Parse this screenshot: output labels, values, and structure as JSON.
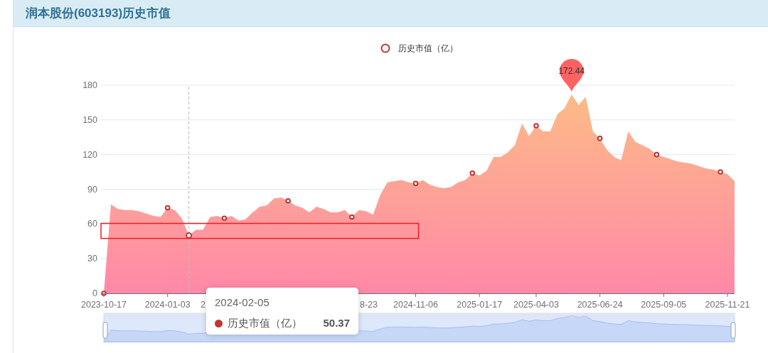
{
  "panel": {
    "title": "润本股份(603193)历史市值"
  },
  "chart": {
    "legend": {
      "color": "#c23531"
    },
    "chart_data": {
      "type": "area",
      "grid": true,
      "categories": [
        "2023-10-17",
        null,
        null,
        null,
        null,
        null,
        null,
        null,
        null,
        "2024-01-03",
        null,
        null,
        null,
        null,
        null,
        null,
        null,
        null,
        null,
        null,
        null,
        null,
        null,
        null,
        null,
        null,
        null,
        null,
        null,
        null,
        null,
        null,
        null,
        null,
        null,
        null,
        null,
        null,
        null,
        null,
        null,
        null,
        null,
        null,
        "2024-11-06",
        null,
        null,
        null,
        null,
        null,
        null,
        null,
        null,
        "2025-01-17",
        null,
        null,
        null,
        null,
        null,
        null,
        null,
        "2025-04-03",
        null,
        null,
        null,
        null,
        null,
        null,
        null,
        null,
        "2025-06-24",
        null,
        null,
        null,
        null,
        null,
        null,
        null,
        null,
        "2025-09-05",
        null,
        null,
        null,
        null,
        null,
        null,
        null,
        null,
        "2025-11-21",
        null
      ],
      "series": [
        {
          "name": "历史市值（亿）",
          "color": "#fdbb87",
          "values": [
            0,
            77,
            73,
            72,
            72,
            71,
            69,
            67,
            66,
            74,
            72,
            65,
            50,
            55,
            55,
            66,
            67,
            65,
            67,
            63,
            64,
            70,
            75,
            76,
            82,
            83,
            80,
            76,
            74,
            70,
            75,
            73,
            70,
            70,
            72,
            66,
            72,
            71,
            68,
            85,
            96,
            97,
            98,
            96,
            95,
            98,
            94,
            92,
            91,
            92,
            96,
            98,
            104,
            102,
            106,
            118,
            118,
            122,
            128,
            147,
            136,
            145,
            140,
            140,
            155,
            160,
            172,
            163,
            170,
            140,
            134,
            124,
            118,
            115,
            140,
            131,
            128,
            125,
            120,
            118,
            116,
            114,
            113,
            112,
            110,
            108,
            107,
            105,
            103,
            97
          ]
        }
      ],
      "ylim": [
        0,
        180
      ],
      "yticks": [
        0,
        30,
        60,
        90,
        120,
        150,
        180
      ],
      "annotations": [
        {
          "text": "172.44",
          "y": 172
        }
      ]
    },
    "covered_axis_labels": [
      {
        "text": "2"
      },
      {
        "text": "8-23"
      }
    ],
    "pin": {
      "color": "#ff6262"
    },
    "highlight_box": {
      "color": "#ee1c25"
    },
    "tooltip": {
      "date": "2024-02-05",
      "series": "历史市值（亿）",
      "value": "50.37",
      "color": "#c23531"
    }
  }
}
